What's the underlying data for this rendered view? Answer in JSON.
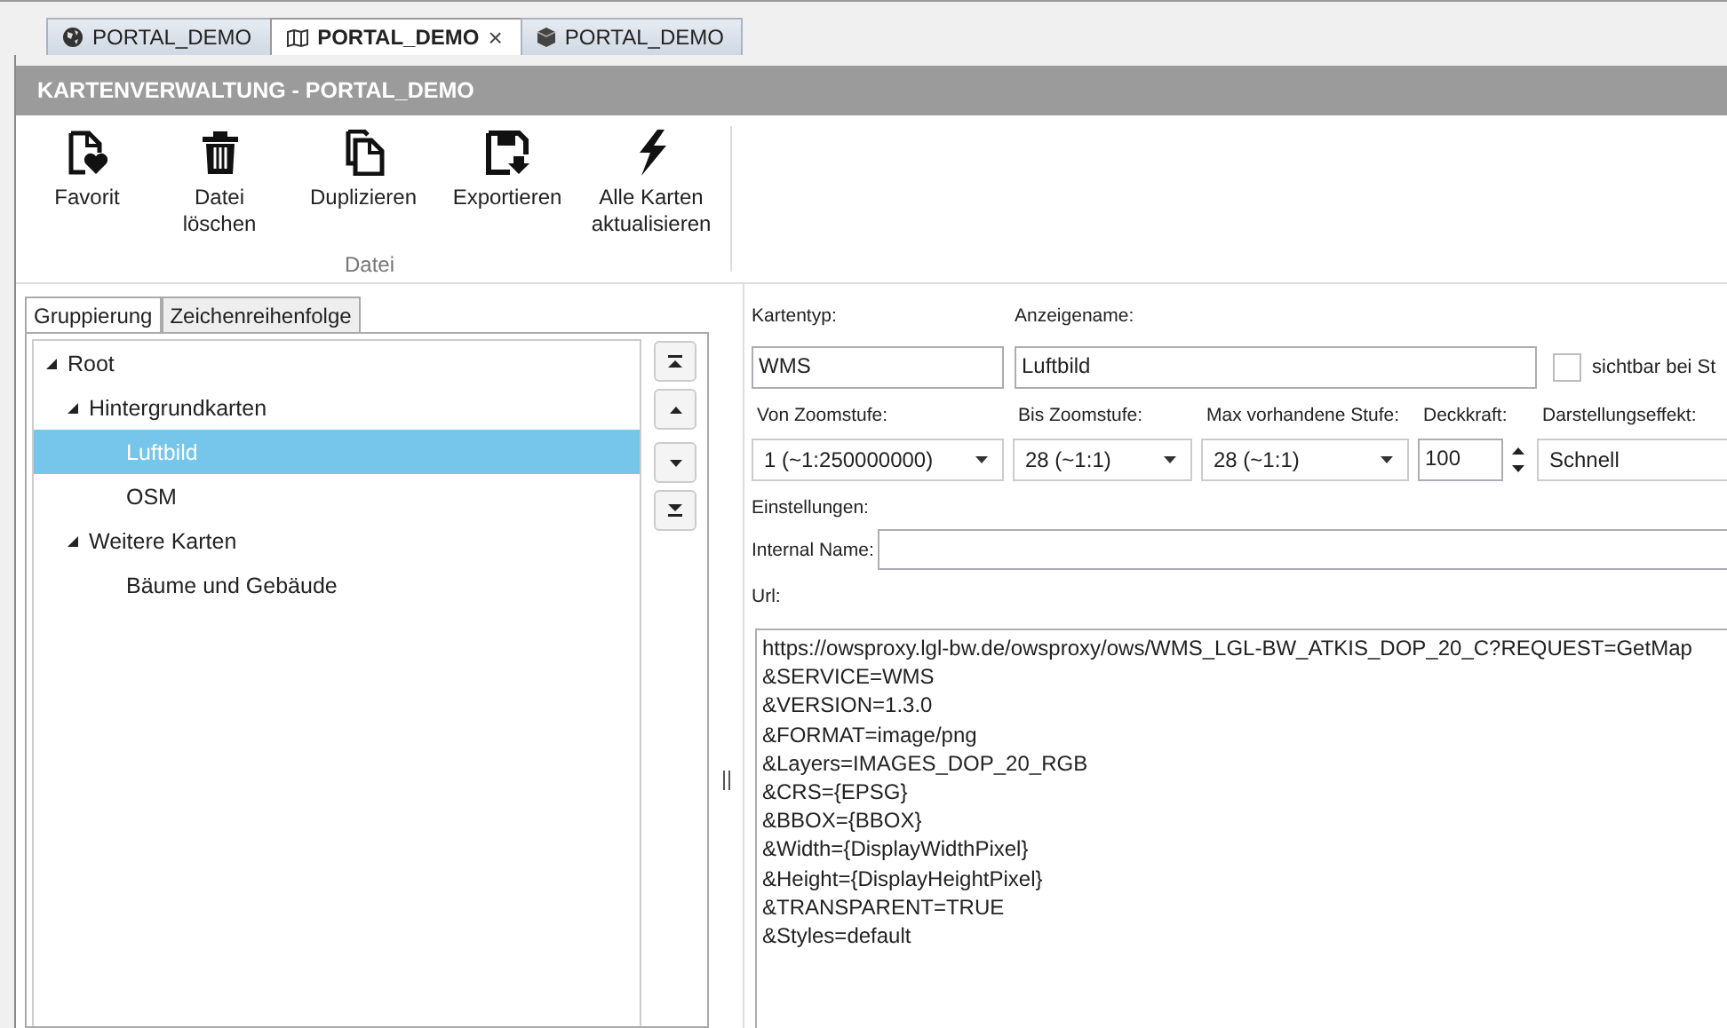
{
  "doc_tabs": [
    {
      "label": "PORTAL_DEMO",
      "selected": false
    },
    {
      "label": "PORTAL_DEMO",
      "selected": true,
      "close": "×"
    },
    {
      "label": "PORTAL_DEMO",
      "selected": false
    }
  ],
  "header": {
    "title": "KARTENVERWALTUNG - PORTAL_DEMO"
  },
  "ribbon": {
    "group": "Datei",
    "buttons": [
      {
        "label": "Favorit"
      },
      {
        "label": "Datei\nlöschen"
      },
      {
        "label": "Duplizieren"
      },
      {
        "label": "Exportieren"
      },
      {
        "label": "Alle Karten\naktualisieren"
      }
    ]
  },
  "side_tabs": [
    {
      "label": "Gruppierung",
      "selected": true
    },
    {
      "label": "Zeichenreihenfolge",
      "selected": false
    }
  ],
  "tree": [
    {
      "label": "Root",
      "expanded": true,
      "selected": false,
      "children": [
        {
          "label": "Hintergrundkarten",
          "expanded": true,
          "selected": false,
          "children": [
            {
              "label": "Luftbild",
              "selected": true
            },
            {
              "label": "OSM",
              "selected": false
            }
          ]
        },
        {
          "label": "Weitere Karten",
          "expanded": true,
          "selected": false,
          "children": [
            {
              "label": "Bäume und Gebäude",
              "selected": false
            }
          ]
        }
      ]
    }
  ],
  "form": {
    "kartentyp": {
      "label": "Kartentyp:",
      "value": "WMS"
    },
    "anzeigename": {
      "label": "Anzeigename:",
      "value": "Luftbild"
    },
    "sichtbar": {
      "label": "sichtbar bei St",
      "checked": false
    },
    "von_zoom": {
      "label": "Von Zoomstufe:",
      "value": "1 (~1:250000000)"
    },
    "bis_zoom": {
      "label": "Bis Zoomstufe:",
      "value": "28 (~1:1)"
    },
    "max_stufe": {
      "label": "Max vorhandene Stufe:",
      "value": "28 (~1:1)"
    },
    "deckkraft": {
      "label": "Deckkraft:",
      "value": "100"
    },
    "effekt": {
      "label": "Darstellungseffekt:",
      "value": "Schnell"
    },
    "einstellungen": "Einstellungen:",
    "internal_name": {
      "label": "Internal Name:"
    },
    "url": {
      "label": "Url:",
      "lines": [
        "https://owsproxy.lgl-bw.de/owsproxy/ows/WMS_LGL-BW_ATKIS_DOP_20_C?REQUEST=GetMap",
        "&SERVICE=WMS",
        "&VERSION=1.3.0",
        "&FORMAT=image/png",
        "&Layers=IMAGES_DOP_20_RGB",
        "&CRS={EPSG}",
        "&BBOX={BBOX}",
        "&Width={DisplayWidthPixel}",
        "&Height={DisplayHeightPixel}",
        "&TRANSPARENT=TRUE",
        "&Styles=default"
      ]
    }
  }
}
